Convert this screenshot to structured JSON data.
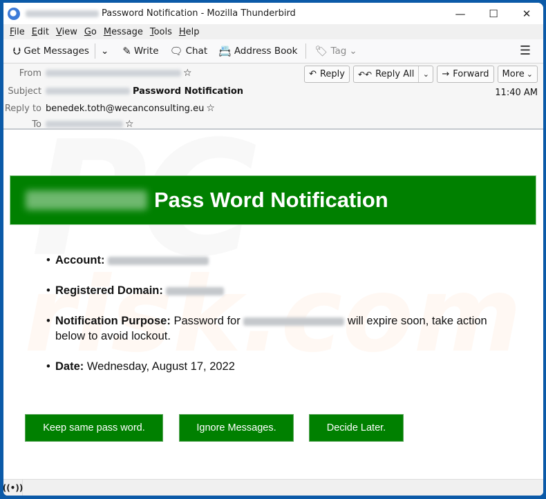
{
  "window": {
    "title": "Password Notification - Mozilla Thunderbird",
    "controls": {
      "minimize": "—",
      "maximize": "☐",
      "close": "✕"
    }
  },
  "menubar": {
    "items": [
      {
        "label": "File",
        "accel": "F",
        "rest": "ile"
      },
      {
        "label": "Edit",
        "accel": "E",
        "rest": "dit"
      },
      {
        "label": "View",
        "accel": "V",
        "rest": "iew"
      },
      {
        "label": "Go",
        "accel": "G",
        "rest": "o"
      },
      {
        "label": "Message",
        "accel": "M",
        "rest": "essage"
      },
      {
        "label": "Tools",
        "accel": "T",
        "rest": "ools"
      },
      {
        "label": "Help",
        "accel": "H",
        "rest": "elp"
      }
    ]
  },
  "toolbar": {
    "get_messages": "Get Messages",
    "write": "Write",
    "chat": "Chat",
    "address_book": "Address Book",
    "tag": "Tag",
    "icons": {
      "get_messages": "⮋",
      "dropdown": "⌄",
      "write": "✎",
      "chat": "🗨",
      "address_book": "📇",
      "tag": "🏷",
      "menu": "☰"
    }
  },
  "header": {
    "labels": {
      "from": "From",
      "subject": "Subject",
      "reply_to": "Reply to",
      "to": "To"
    },
    "subject": "Password Notification",
    "reply_to": "benedek.toth@wecanconsulting.eu",
    "time": "11:40 AM",
    "buttons": {
      "reply": "Reply",
      "reply_all": "Reply All",
      "forward": "Forward",
      "more": "More"
    },
    "icons": {
      "reply": "↶",
      "reply_all": "↶↶",
      "forward": "→",
      "star": "☆",
      "chevron": "⌄"
    }
  },
  "email": {
    "banner_title": "Pass Word Notification",
    "items": [
      {
        "label": "Account:",
        "value": ""
      },
      {
        "label": "Registered Domain:",
        "value": ""
      },
      {
        "label": "Notification Purpose:",
        "prefix": "Password for",
        "suffix": "will expire soon, take action below to avoid lockout."
      },
      {
        "label": "Date:",
        "value": "Wednesday, August 17, 2022"
      }
    ],
    "buttons": [
      "Keep same pass word.",
      "Ignore Messages.",
      "Decide Later."
    ],
    "brand_color": "#008000"
  },
  "statusbar": {
    "activity_icon": "((•))"
  },
  "watermark": {
    "line1": "PC",
    "line2": "risk.com"
  }
}
